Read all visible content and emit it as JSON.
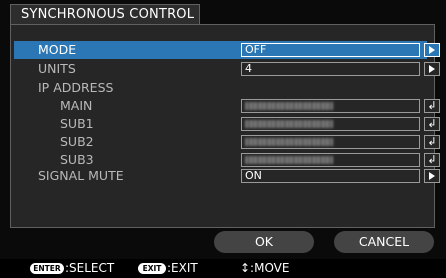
{
  "dialog": {
    "title": "SYNCHRONOUS CONTROL"
  },
  "rows": [
    {
      "label": "MODE",
      "value": "OFF",
      "control": "arrow"
    },
    {
      "label": "UNITS",
      "value": "4",
      "control": "arrow"
    },
    {
      "label": "IP ADDRESS"
    },
    {
      "label": "MAIN",
      "value_obscured": true,
      "control": "enter"
    },
    {
      "label": "SUB1",
      "value_obscured": true,
      "control": "enter"
    },
    {
      "label": "SUB2",
      "value_obscured": true,
      "control": "enter"
    },
    {
      "label": "SUB3",
      "value_obscured": true,
      "control": "enter"
    },
    {
      "label": "SIGNAL MUTE",
      "value": "ON",
      "control": "arrow"
    }
  ],
  "selected_row": "MODE",
  "buttons": {
    "ok": "OK",
    "cancel": "CANCEL"
  },
  "footer": {
    "enter_key": "ENTER",
    "select": ":SELECT",
    "exit_key": "EXIT",
    "exit": ":EXIT",
    "move": "↕:MOVE"
  },
  "colors": {
    "selection": "#2b77b6",
    "panel": "#262626",
    "background": "#0a0a0a"
  },
  "icons": {
    "arrow": "triangle-right-icon",
    "enter": "enter-return-icon"
  }
}
